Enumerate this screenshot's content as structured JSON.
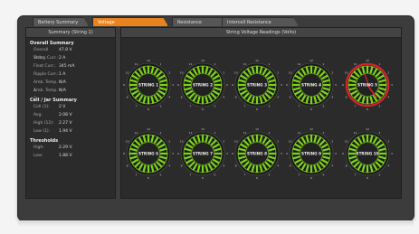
{
  "tabs": [
    {
      "label": "Battery Summary",
      "active": false
    },
    {
      "label": "Voltage",
      "active": true
    },
    {
      "label": "Resistance",
      "active": false
    },
    {
      "label": "Intercell Resistance",
      "active": false
    }
  ],
  "summary": {
    "title": "Summary (String 1)",
    "overall_title": "Overall Summary",
    "overall": [
      {
        "k": "Overall Volts:",
        "v": "47.8 V"
      },
      {
        "k": "String Curr.:",
        "v": "2 A"
      },
      {
        "k": "Float Curr.:",
        "v": "345 mA"
      },
      {
        "k": "Ripple Curr.:",
        "v": "1 A"
      },
      {
        "k": "Amb. Temp. 1:",
        "v": "N/A"
      },
      {
        "k": "Amb. Temp. 2:",
        "v": "N/A"
      }
    ],
    "cell_title": "Cell / Jar Summary",
    "cell": [
      {
        "k": "Cell (1):",
        "v": "2 V"
      },
      {
        "k": "Avg:",
        "v": "2.08 V"
      },
      {
        "k": "High (12):",
        "v": "2.27 V"
      },
      {
        "k": "Low (1):",
        "v": "1.94 V"
      }
    ],
    "thresh_title": "Thresholds",
    "thresh": [
      {
        "k": "High:",
        "v": "2.29 V"
      },
      {
        "k": "Low:",
        "v": "1.88 V"
      }
    ]
  },
  "gauges_title": "String Voltage Readings (Volts)",
  "gauges": [
    {
      "label": "STRING 1",
      "alarm": false
    },
    {
      "label": "STRING 2",
      "alarm": false
    },
    {
      "label": "STRING 3",
      "alarm": false
    },
    {
      "label": "STRING 4",
      "alarm": false
    },
    {
      "label": "STRING 5",
      "alarm": true
    },
    {
      "label": "STRING 6",
      "alarm": false
    },
    {
      "label": "STRING 7",
      "alarm": false
    },
    {
      "label": "STRING 8",
      "alarm": false
    },
    {
      "label": "STRING 9",
      "alarm": false
    },
    {
      "label": "STRING 10",
      "alarm": false
    }
  ],
  "colors": {
    "accent": "#e8831d",
    "gauge_green": "#7fd21c",
    "gauge_alarm": "#d8202a"
  }
}
